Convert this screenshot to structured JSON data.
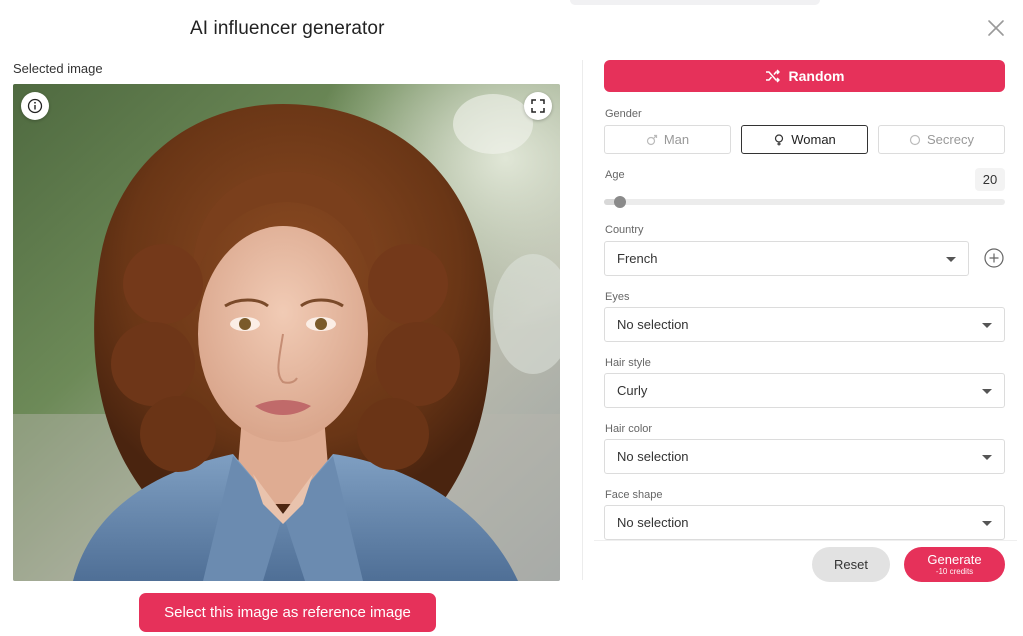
{
  "dialog": {
    "title": "AI influencer generator"
  },
  "preview": {
    "label": "Selected image",
    "select_button": "Select this image as reference image"
  },
  "form": {
    "random_label": "Random",
    "gender": {
      "label": "Gender",
      "options": [
        "Man",
        "Woman",
        "Secrecy"
      ],
      "selected": "Woman"
    },
    "age": {
      "label": "Age",
      "value": "20",
      "fraction": 0.04
    },
    "country": {
      "label": "Country",
      "value": "French"
    },
    "eyes": {
      "label": "Eyes",
      "value": "No selection"
    },
    "hair_style": {
      "label": "Hair style",
      "value": "Curly"
    },
    "hair_color": {
      "label": "Hair color",
      "value": "No selection"
    },
    "face_shape": {
      "label": "Face shape",
      "value": "No selection"
    }
  },
  "footer": {
    "reset_label": "Reset",
    "generate_label": "Generate",
    "generate_sub": "-10 credits"
  },
  "colors": {
    "accent": "#e6315a",
    "neutral_button": "#e2e2e2"
  },
  "icons": {
    "close": "close-icon",
    "info": "info-icon",
    "fullscreen": "fullscreen-icon",
    "random": "shuffle-icon",
    "man": "male-icon",
    "woman": "female-icon",
    "secrecy": "circle-icon",
    "add": "plus-circle-icon"
  }
}
